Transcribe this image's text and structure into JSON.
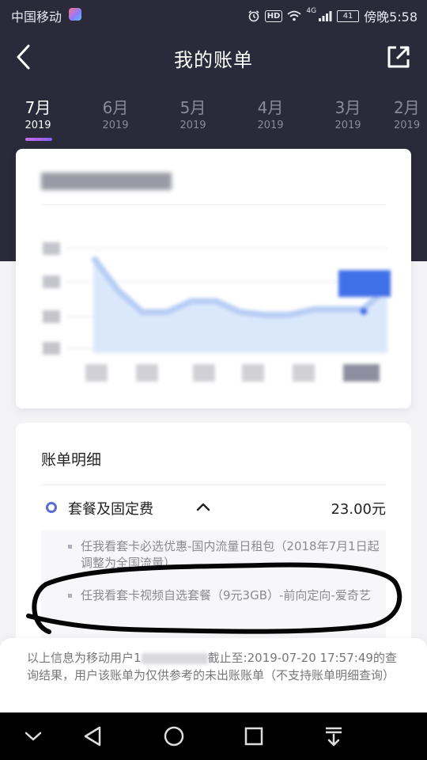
{
  "status_bar": {
    "carrier": "中国移动",
    "hd": "HD",
    "network": "4G",
    "battery": "41",
    "time": "傍晚5:58"
  },
  "header": {
    "title": "我的账单"
  },
  "months": [
    {
      "month": "7月",
      "year": "2019",
      "active": true
    },
    {
      "month": "6月",
      "year": "2019",
      "active": false
    },
    {
      "month": "5月",
      "year": "2019",
      "active": false
    },
    {
      "month": "4月",
      "year": "2019",
      "active": false
    },
    {
      "month": "3月",
      "year": "2019",
      "active": false
    },
    {
      "month": "2月",
      "year": "2019",
      "active": false
    }
  ],
  "chart_data": {
    "type": "area",
    "title": "",
    "series": [
      {
        "values": [
          70,
          46,
          30,
          30,
          38,
          38,
          30,
          28,
          28,
          32,
          32,
          32,
          48
        ]
      }
    ],
    "note": "chart content is blurred/pixelated in the original"
  },
  "details": {
    "title": "账单明细",
    "package": {
      "label": "套餐及固定费",
      "amount": "23.00元",
      "items": [
        {
          "text": "任我看套卡必选优惠-国内流量日租包（2018年7月1日起调整为全国流量）"
        },
        {
          "text": "任我看套卡视频自选套餐（9元3GB）-前向定向-爱奇艺"
        }
      ]
    }
  },
  "notice": {
    "part1": "以上信息为移动用户1",
    "part2": "截止至:2019-07-20 17:57:49的查询结果，用户该账单为仅供参考的未出账账单（不支持账单明细查询）"
  },
  "colors": {
    "header_bg": "#2a2a3a",
    "accent": "#5b6cd8",
    "tab_indicator": "#b068f0",
    "chart_fill": "#dbe8fb",
    "chart_line": "#b7cdf5",
    "chart_highlight": "#3f6fe8"
  }
}
